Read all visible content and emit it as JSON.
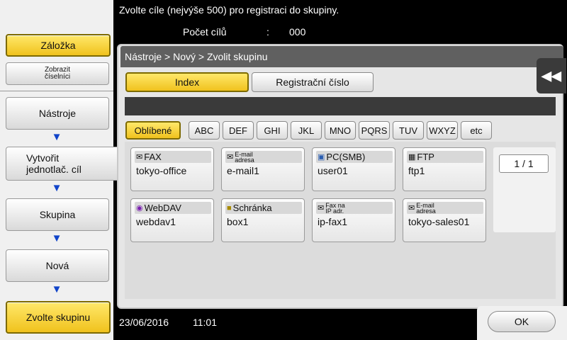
{
  "header": {
    "instruction": "Zvolte cíle (nejvýše 500) pro registraci do skupiny.",
    "count_label": "Počet cílů",
    "count_colon": ":",
    "count_value": "000"
  },
  "sidebar": {
    "bookmark": "Záložka",
    "show_keypad_line1": "Zobrazit",
    "show_keypad_line2": "číselníci",
    "steps": [
      {
        "label": "Nástroje"
      },
      {
        "label_line1": "Vytvořit",
        "label_line2": "jednotlač. cíl"
      },
      {
        "label": "Skupina"
      },
      {
        "label": "Nová"
      },
      {
        "label": "Zvolte skupinu"
      }
    ]
  },
  "breadcrumb": "Nástroje > Nový > Zvolit skupinu",
  "tabs": {
    "index": "Index",
    "registration": "Registrační číslo"
  },
  "filters": [
    "Oblíbené",
    "ABC",
    "DEF",
    "GHI",
    "JKL",
    "MNO",
    "PQRS",
    "TUV",
    "WXYZ",
    "etc"
  ],
  "destinations": [
    {
      "type": "FAX",
      "icon": "fax-icon",
      "name": "tokyo-office"
    },
    {
      "type_line1": "E-mail",
      "type_line2": "adresa",
      "icon": "email-icon",
      "name": "e-mail1"
    },
    {
      "type": "PC(SMB)",
      "icon": "pc-icon",
      "name": "user01"
    },
    {
      "type": "FTP",
      "icon": "ftp-icon",
      "name": "ftp1"
    },
    {
      "type": "WebDAV",
      "icon": "webdav-icon",
      "name": "webdav1"
    },
    {
      "type": "Schránka",
      "icon": "box-icon",
      "name": "box1"
    },
    {
      "type_line1": "Fax na",
      "type_line2": "IP adr.",
      "icon": "ip-fax-icon",
      "name": "ip-fax1"
    },
    {
      "type_line1": "E-mail",
      "type_line2": "adresa",
      "icon": "email-icon",
      "name": "tokyo-sales01"
    }
  ],
  "page_indicator": "1 / 1",
  "footer": {
    "date": "23/06/2016",
    "time": "11:01",
    "ok": "OK"
  },
  "colors": {
    "accent_yellow": "#f0c21d",
    "arrow_blue": "#1144c9",
    "breadcrumb_bg": "#606060"
  }
}
